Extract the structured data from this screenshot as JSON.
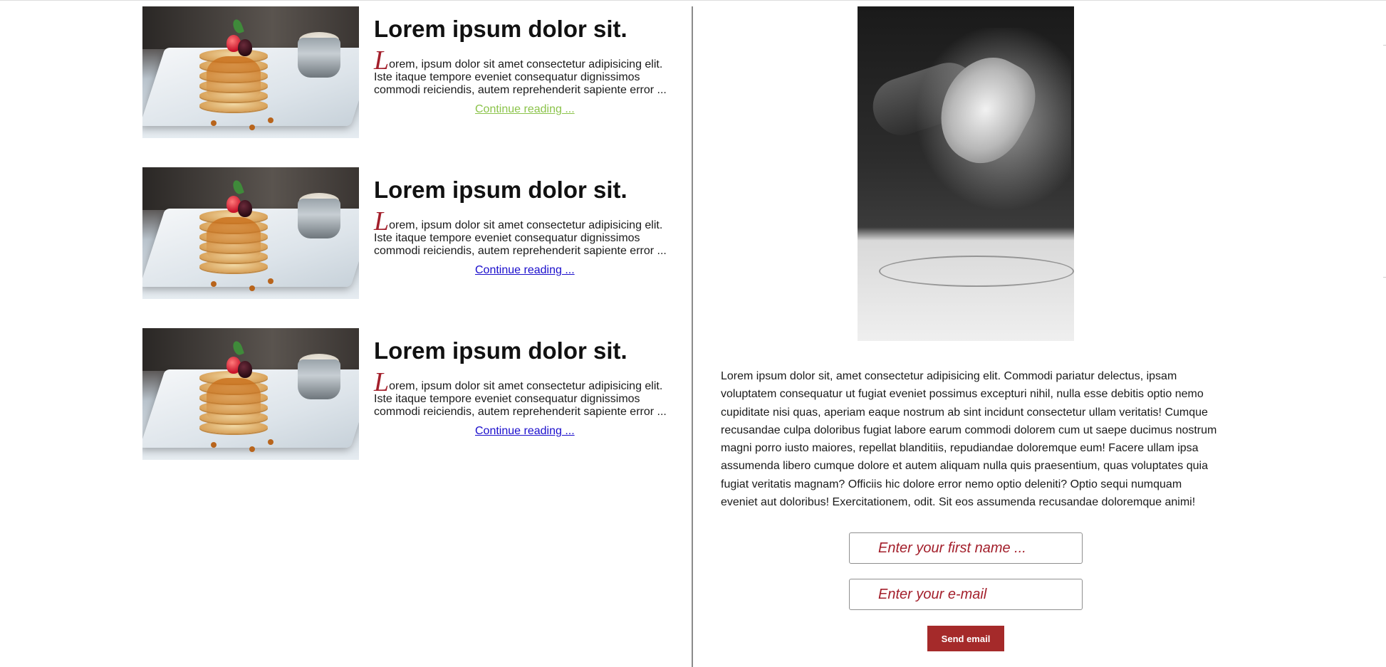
{
  "articles": [
    {
      "title": "Lorem ipsum dolor sit.",
      "dropcap": "L",
      "text": "orem, ipsum dolor sit amet consectetur adipisicing elit. Iste itaque tempore eveniet consequatur dignissimos commodi reiciendis, autem reprehenderit sapiente error ...",
      "link": "Continue reading ..."
    },
    {
      "title": "Lorem ipsum dolor sit.",
      "dropcap": "L",
      "text": "orem, ipsum dolor sit amet consectetur adipisicing elit. Iste itaque tempore eveniet consequatur dignissimos commodi reiciendis, autem reprehenderit sapiente error ...",
      "link": "Continue reading ..."
    },
    {
      "title": "Lorem ipsum dolor sit.",
      "dropcap": "L",
      "text": "orem, ipsum dolor sit amet consectetur adipisicing elit. Iste itaque tempore eveniet consequatur dignissimos commodi reiciendis, autem reprehenderit sapiente error ...",
      "link": "Continue reading ..."
    }
  ],
  "right": {
    "paragraph": "Lorem ipsum dolor sit, amet consectetur adipisicing elit. Commodi pariatur delectus, ipsam voluptatem consequatur ut fugiat eveniet possimus excepturi nihil, nulla esse debitis optio nemo cupiditate nisi quas, aperiam eaque nostrum ab sint incidunt consectetur ullam veritatis! Cumque recusandae culpa doloribus fugiat labore earum commodi dolorem cum ut saepe ducimus nostrum magni porro iusto maiores, repellat blanditiis, repudiandae doloremque eum! Facere ullam ipsa assumenda libero cumque dolore et autem aliquam nulla quis praesentium, quas voluptates quia fugiat veritatis magnam? Officiis hic dolore error nemo optio deleniti? Optio sequi numquam eveniet aut doloribus! Exercitationem, odit. Sit eos assumenda recusandae doloremque animi!"
  },
  "form": {
    "first_name_placeholder": "Enter your first name ...",
    "email_placeholder": "Enter your e-mail",
    "send_label": "Send email"
  },
  "colors": {
    "accent_red": "#a31f2b",
    "button_red": "#a52a2a",
    "visited_link": "#8bc34a",
    "link": "#1a0dcc"
  },
  "icons": {
    "article_image": "pancake-stack-photo",
    "hero_image": "flour-hands-photo"
  }
}
